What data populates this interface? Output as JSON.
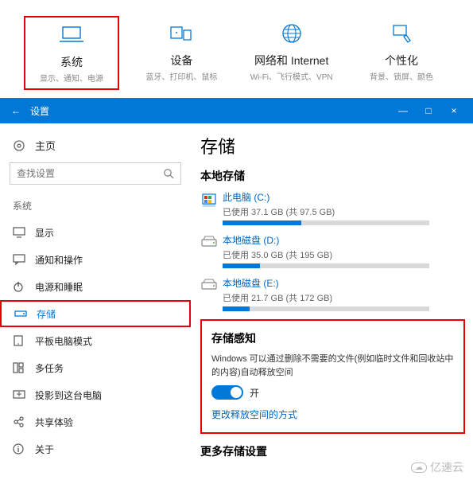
{
  "categories": [
    {
      "title": "系统",
      "sub": "显示、通知、电源"
    },
    {
      "title": "设备",
      "sub": "蓝牙、打印机、鼠标"
    },
    {
      "title": "网络和 Internet",
      "sub": "Wi-Fi、飞行模式、VPN"
    },
    {
      "title": "个性化",
      "sub": "背景、锁屏、颜色"
    }
  ],
  "titlebar": {
    "title": "设置",
    "min": "—",
    "max": "□",
    "close": "×",
    "back": "←"
  },
  "sidebar": {
    "home": "主页",
    "search_placeholder": "查找设置",
    "section": "系统",
    "items": [
      "显示",
      "通知和操作",
      "电源和睡眠",
      "存储",
      "平板电脑模式",
      "多任务",
      "投影到这台电脑",
      "共享体验",
      "关于"
    ]
  },
  "content": {
    "title": "存储",
    "local": "本地存储",
    "drives": [
      {
        "name": "此电脑 (C:)",
        "usage": "已使用 37.1 GB (共 97.5 GB)",
        "pct": 38
      },
      {
        "name": "本地磁盘 (D:)",
        "usage": "已使用 35.0 GB (共 195 GB)",
        "pct": 18
      },
      {
        "name": "本地磁盘 (E:)",
        "usage": "已使用 21.7 GB (共 172 GB)",
        "pct": 13
      }
    ],
    "sense": {
      "title": "存储感知",
      "desc": "Windows 可以通过删除不需要的文件(例如临时文件和回收站中的内容)自动释放空间",
      "toggle": "开",
      "link": "更改释放空间的方式"
    },
    "more": "更多存储设置"
  },
  "watermark": "亿速云"
}
